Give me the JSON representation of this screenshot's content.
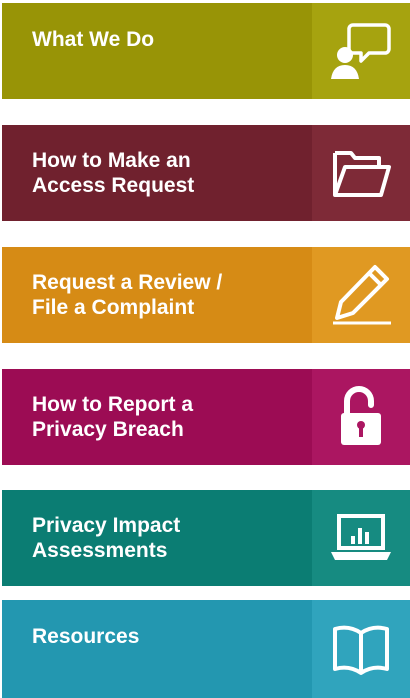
{
  "menu": {
    "items": [
      {
        "label": "What We Do",
        "icon": "speech-bubble-person-icon",
        "color": "#989406",
        "icon_bg": "#a6a30f"
      },
      {
        "label": "How to Make an\nAccess Request",
        "icon": "folder-icon",
        "color": "#70212e",
        "icon_bg": "#7e2a37"
      },
      {
        "label": "Request a Review /\nFile a Complaint",
        "icon": "pencil-icon",
        "color": "#d68b15",
        "icon_bg": "#e09922"
      },
      {
        "label": "How to Report a\nPrivacy Breach",
        "icon": "unlocked-padlock-icon",
        "color": "#9c0c54",
        "icon_bg": "#ab1661"
      },
      {
        "label": "Privacy Impact\nAssessments",
        "icon": "laptop-chart-icon",
        "color": "#0b7d73",
        "icon_bg": "#168b81"
      },
      {
        "label": "Resources",
        "icon": "open-book-icon",
        "color": "#2397b0",
        "icon_bg": "#30a4bd"
      }
    ]
  }
}
